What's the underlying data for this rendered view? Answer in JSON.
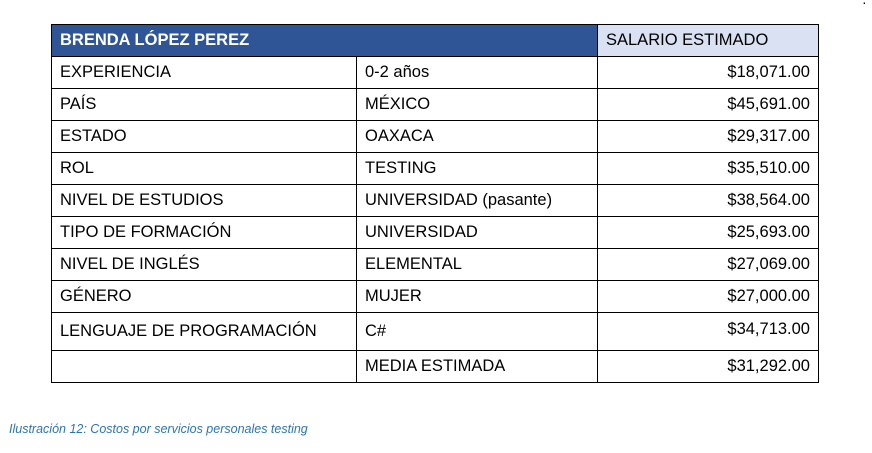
{
  "corner_mark": "·",
  "table": {
    "header": {
      "name": "BRENDA LÓPEZ PEREZ",
      "salary_label": "SALARIO ESTIMADO"
    },
    "rows": [
      {
        "label": "EXPERIENCIA",
        "value": "0-2 años",
        "salary": "$18,071.00"
      },
      {
        "label": "PAÍS",
        "value": "MÉXICO",
        "salary": "$45,691.00"
      },
      {
        "label": "ESTADO",
        "value": "OAXACA",
        "salary": "$29,317.00"
      },
      {
        "label": "ROL",
        "value": "TESTING",
        "salary": "$35,510.00"
      },
      {
        "label": "NIVEL DE ESTUDIOS",
        "value": "UNIVERSIDAD (pasante)",
        "salary": "$38,564.00"
      },
      {
        "label": "TIPO DE FORMACIÓN",
        "value": "UNIVERSIDAD",
        "salary": "$25,693.00"
      },
      {
        "label": "NIVEL DE INGLÉS",
        "value": "ELEMENTAL",
        "salary": "$27,069.00"
      },
      {
        "label": "GÉNERO",
        "value": "MUJER",
        "salary": "$27,000.00"
      },
      {
        "label": "LENGUAJE DE PROGRAMACIÓN",
        "value": "C#",
        "salary": "$34,713.00"
      }
    ],
    "summary": {
      "label": "",
      "value": "MEDIA ESTIMADA",
      "salary": "$31,292.00"
    }
  },
  "caption": "Ilustración 12: Costos por servicios personales testing",
  "colors": {
    "header_bg": "#2f5597",
    "header_salary_bg": "#d9e1f2",
    "caption": "#2e74b5"
  }
}
